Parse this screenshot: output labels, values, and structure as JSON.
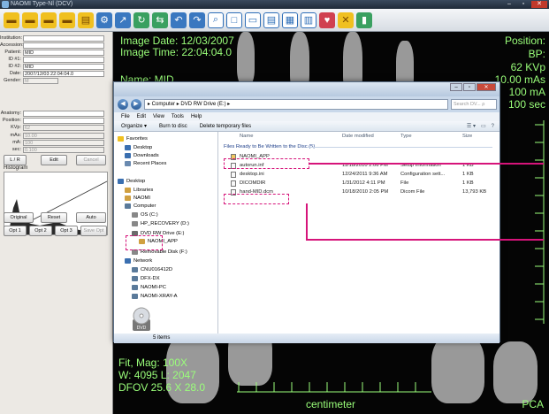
{
  "window": {
    "title": "NAOMI Type-Nl (DCV)"
  },
  "toolbar": {
    "icons": [
      "folder-icon",
      "folder-open-icon",
      "folder-icon",
      "folder-icon",
      "document-icon",
      "settings-icon",
      "export-icon",
      "rotate-icon",
      "flip-icon",
      "undo-icon",
      "redo-icon",
      "zoom-icon",
      "layout-1-icon",
      "layout-2-icon",
      "layout-3-icon",
      "layout-4-icon",
      "layout-5-icon",
      "heart-icon",
      "tools-icon",
      "trash-icon"
    ]
  },
  "patient": {
    "institution_label": "Institution:",
    "accession_label": "Accession:",
    "patient_label": "Patient:",
    "patient_value": "MID",
    "id1_label": "ID #1:",
    "id2_label": "ID #2:",
    "id2_value": "MID",
    "date_label": "Date:",
    "date_value": "2007/12/03 22:04:04.0",
    "gender_label": "Gender:",
    "gender_value": "M"
  },
  "exposure": {
    "anatomy_label": "Anatomy:",
    "position_label": "Position:",
    "kvp_label": "KVp:",
    "kvp_value": "62",
    "mas_label": "mAs:",
    "mas_value": "10.00",
    "ma_label": "mA:",
    "ma_value": "100",
    "sec_label": "sec:",
    "sec_value": "0.100",
    "lr_button": "L / R",
    "edit_button": "Edit",
    "cancel_button": "Cancel"
  },
  "histogram": {
    "label": "Histogram",
    "original_button": "Original",
    "reset_button": "Reset",
    "auto_button": "Auto"
  },
  "opt_buttons": {
    "opt1": "Opt 1",
    "opt2": "Opt 2",
    "opt3": "Opt 3",
    "save_opt": "Save Opt"
  },
  "overlay": {
    "image_date": "Image Date: 12/03/2007",
    "image_time": "Image Time: 22:04:04.0",
    "name_line": "Name: MID",
    "position": "Position:",
    "bp": "BP:",
    "kvp": "62 KVp",
    "mas": "10.00 mAs",
    "ma": "100 mA",
    "sec": "100 sec",
    "fit_mag": "Fit, Mag: 100X",
    "window_level": "W: 4095 L: 2047",
    "dfov": "DFOV 25.6 X 28.0",
    "ruler_unit": "centimeter",
    "corner": "PCA"
  },
  "explorer": {
    "breadcrumb": "▸ Computer ▸ DVD RW Drive (E:) ▸",
    "search_placeholder": "Search DV... ρ",
    "menu": [
      "File",
      "Edit",
      "View",
      "Tools",
      "Help"
    ],
    "commands": {
      "organize": "Organize ▾",
      "burn": "Burn to disc",
      "delete_temp": "Delete temporary files"
    },
    "nav": {
      "favorites": "Favorites",
      "desktop": "Desktop",
      "downloads": "Downloads",
      "recent": "Recent Places",
      "desktop2": "Desktop",
      "libraries": "Libraries",
      "naomi": "NAOMI",
      "computer": "Computer",
      "os_c": "OS (C:)",
      "hp_recovery": "HP_RECOVERY (D:)",
      "dvd_rw": "DVD RW Drive (E:)",
      "naomi_app": "NAOMI_APP",
      "removable": "Removable Disk (F:)",
      "network": "Network",
      "net1": "CNU016412D",
      "net2": "DFX-DX",
      "net3": "NAOMI-PC",
      "net4": "NAOMI-XRAY-A"
    },
    "columns": {
      "name": "Name",
      "date": "Date modified",
      "type": "Type",
      "size": "Size"
    },
    "group": "Files Ready to Be Written to the Disc (5)",
    "files": [
      {
        "name": "NAOMI_APP",
        "date": "",
        "type": "",
        "size": ""
      },
      {
        "name": "autorun.inf",
        "date": "11/18/2010 2:06 PM",
        "type": "Setup Information",
        "size": "1 KB"
      },
      {
        "name": "desktop.ini",
        "date": "12/24/2011 9:36 AM",
        "type": "Configuration sett...",
        "size": "1 KB"
      },
      {
        "name": "DICOMDIR",
        "date": "1/31/2012 4:11 PM",
        "type": "File",
        "size": "1 KB"
      },
      {
        "name": "hand-MID.dcm",
        "date": "10/18/2010 2:05 PM",
        "type": "Dicom File",
        "size": "13,793 KB"
      }
    ],
    "status": "5 items",
    "drive_label": "DVD"
  },
  "colors": {
    "overlay_green": "#9aff7a",
    "highlight_magenta": "#d6147a"
  }
}
